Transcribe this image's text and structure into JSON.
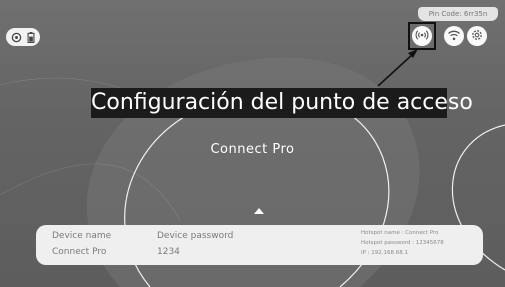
{
  "status": {
    "pin_code": "Pin Code: 6rr35n",
    "left_icons": [
      "cast-icon",
      "battery-icon"
    ],
    "right_icons": [
      "hotspot-icon",
      "wifi-icon",
      "settings-icon"
    ]
  },
  "annotation": {
    "label": "Configuración del punto de acceso"
  },
  "main": {
    "device_title": "Connect Pro"
  },
  "info": {
    "device_name_label": "Device name",
    "device_name_value": "Connect Pro",
    "password_label": "Device password",
    "password_value": "1234",
    "hotspot_name": "Hotspot name : Connect Pro",
    "hotspot_password": "Hotspot password : 12345678",
    "ip": "IP : 192.168.68.1"
  },
  "colors": {
    "background": "#666666",
    "banner": "#1b1b1b",
    "info_panel": "#efefef"
  }
}
